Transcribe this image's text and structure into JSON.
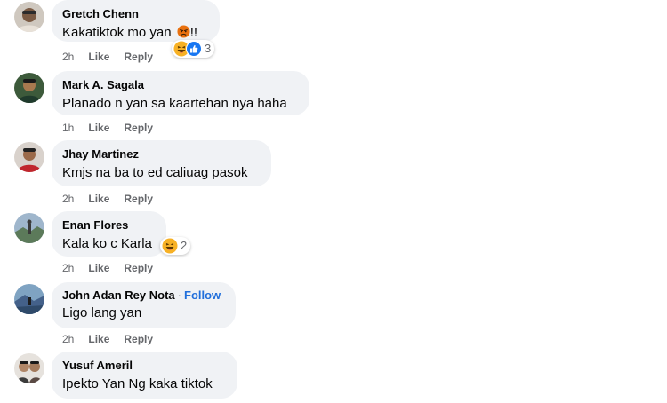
{
  "comments": [
    {
      "author": "Gretch Chenn",
      "text_before_emoji": "Kakatiktok mo yan ",
      "text_emoji": "angry-emoji",
      "text_after_emoji": "!!",
      "time": "2h",
      "like": "Like",
      "reply": "Reply",
      "reactions": [
        "haha-reaction-icon",
        "like-reaction-icon"
      ],
      "reaction_count": "3"
    },
    {
      "author": "Mark A. Sagala",
      "text": "Planado n yan sa kaartehan nya haha",
      "time": "1h",
      "like": "Like",
      "reply": "Reply"
    },
    {
      "author": "Jhay Martinez",
      "text": "Kmjs na ba to ed caliuag pasok",
      "time": "2h",
      "like": "Like",
      "reply": "Reply"
    },
    {
      "author": "Enan Flores",
      "text": "Kala ko c Karla",
      "time": "2h",
      "like": "Like",
      "reply": "Reply",
      "reactions": [
        "haha-reaction-icon"
      ],
      "reaction_count": "2"
    },
    {
      "author": "John Adan Rey Nota",
      "separator": "·",
      "follow": "Follow",
      "text": "Ligo lang yan",
      "time": "2h",
      "like": "Like",
      "reply": "Reply"
    },
    {
      "author": "Yusuf Ameril",
      "text": "Ipekto Yan Ng kaka tiktok"
    }
  ],
  "colors": {
    "bubble": "#f0f2f5",
    "meta_text": "#65676b",
    "follow_link": "#216fdb",
    "like_blue": "#1877f2",
    "haha_yellow": "#f7b125",
    "angry_orange": "#e9710f"
  }
}
